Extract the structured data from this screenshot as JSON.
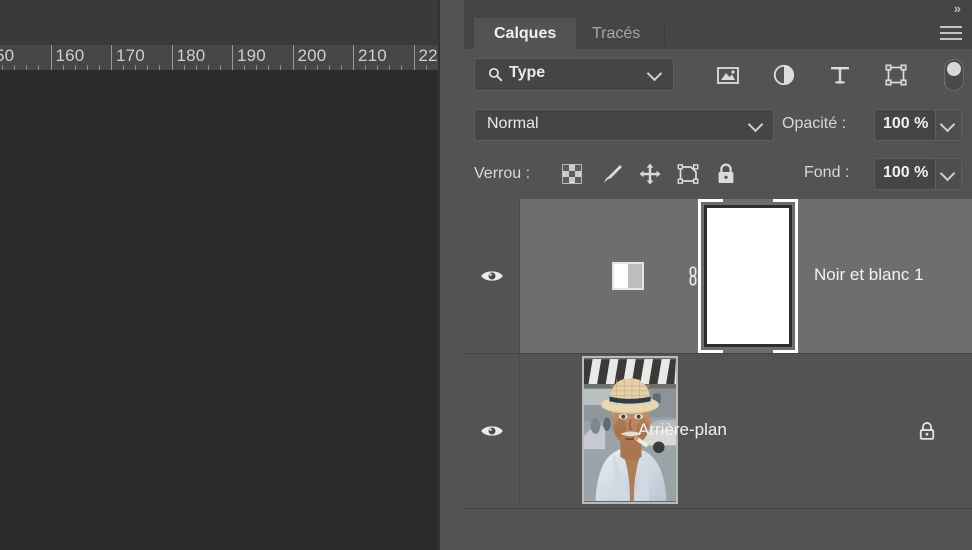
{
  "app": {
    "collapse_icon": "double-chevron-right-icon",
    "panel_menu_icon": "hamburger-menu-icon"
  },
  "document": {
    "ruler": {
      "unit_hint": "px",
      "labels": [
        "50",
        "160",
        "170",
        "180",
        "190",
        "200",
        "210",
        "22"
      ],
      "full_labels": [
        "150",
        "160",
        "170",
        "180",
        "190",
        "200",
        "210",
        "220"
      ]
    }
  },
  "panel": {
    "tabs": [
      {
        "label": "Calques",
        "active": true
      },
      {
        "label": "Tracés",
        "active": false
      }
    ],
    "filter": {
      "search_icon": "search-icon",
      "select_value": "Type",
      "caret_icon": "chevron-down-icon",
      "icons": [
        {
          "name": "pixel-layer-filter-icon",
          "title": "Image"
        },
        {
          "name": "adjustment-layer-filter-icon",
          "title": "Réglage"
        },
        {
          "name": "type-layer-filter-icon",
          "title": "Texte"
        },
        {
          "name": "shape-layer-filter-icon",
          "title": "Forme"
        },
        {
          "name": "smart-object-filter-icon",
          "title": "Objet dynamique"
        }
      ],
      "toggle_on": true
    },
    "blend": {
      "mode": "Normal",
      "opacity_label": "Opacité :",
      "opacity_value": "100 %"
    },
    "lock": {
      "label": "Verrou :",
      "icons": [
        {
          "name": "lock-transparency-icon",
          "title": "Verrouiller les pixels transparents"
        },
        {
          "name": "lock-image-pixels-icon",
          "title": "Verrouiller les pixels de l'image"
        },
        {
          "name": "lock-position-icon",
          "title": "Verrouiller la position"
        },
        {
          "name": "lock-artboard-icon",
          "title": "Empêcher l'imbrication automatique"
        },
        {
          "name": "lock-all-icon",
          "title": "Tout verrouiller"
        }
      ],
      "fill_label": "Fond :",
      "fill_value": "100 %"
    },
    "layers": [
      {
        "name": "Noir et blanc 1",
        "selected": true,
        "visible": true,
        "type": "adjustment",
        "linked": true,
        "mask_active": true
      },
      {
        "name": "Arrière-plan",
        "selected": false,
        "visible": true,
        "type": "image",
        "locked": true
      }
    ]
  },
  "colors": {
    "panel_bg": "#535353",
    "row_selected_bg": "#6e6e6e",
    "field_bg": "#454545",
    "canvas_bg": "#2b2b2b",
    "ruler_bg": "#474747",
    "text": "#f0f0f0",
    "text_dim": "#a7a7a7"
  }
}
